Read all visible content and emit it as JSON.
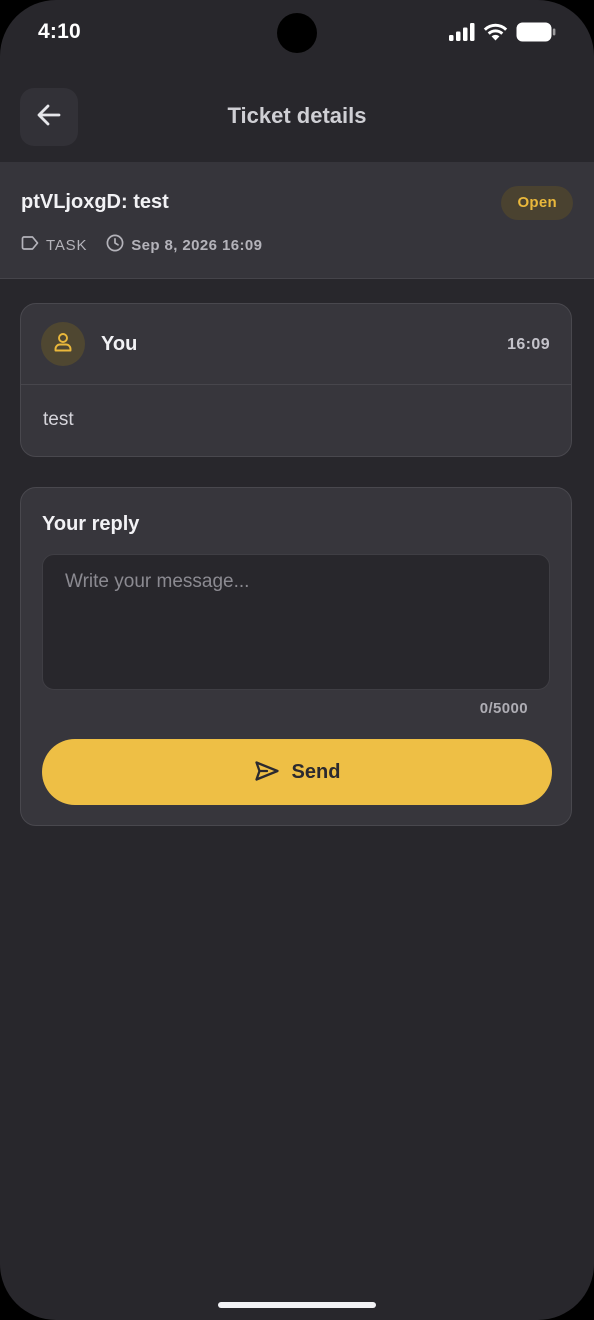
{
  "status_bar": {
    "time": "4:10",
    "icons": [
      "cellular-signal-icon",
      "wifi-icon",
      "battery-icon"
    ]
  },
  "header": {
    "title": "Ticket details",
    "back_icon": "arrow-left-icon"
  },
  "ticket": {
    "title": "ptVLjoxgD: test",
    "status": "Open",
    "type": "TASK",
    "created": "Sep 8, 2026 16:09"
  },
  "message": {
    "author": "You",
    "time": "16:09",
    "body": "test",
    "avatar_icon": "user-icon"
  },
  "reply": {
    "title": "Your reply",
    "value": "",
    "placeholder": "Write your message...",
    "char_count": "0/5000",
    "send_label": "Send",
    "send_icon": "send-icon"
  },
  "colors": {
    "background": "#28272c",
    "surface": "#37363c",
    "accent": "#eebf45",
    "badge_text": "#eab83b"
  }
}
